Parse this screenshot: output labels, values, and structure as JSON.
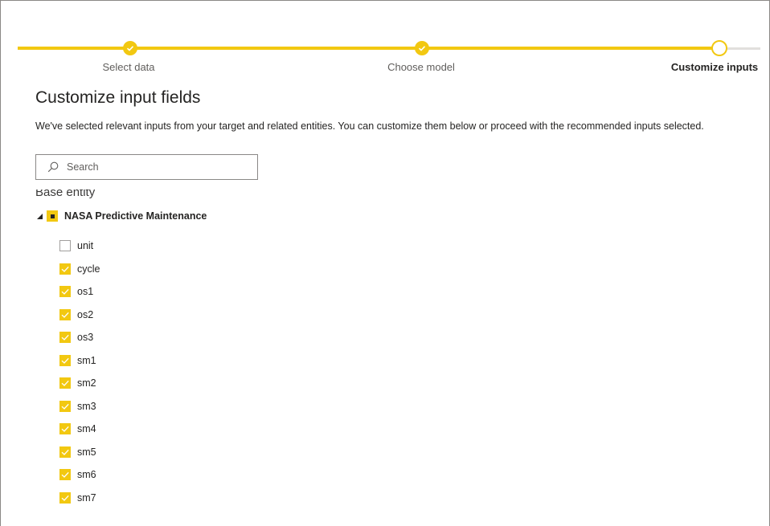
{
  "stepper": {
    "steps": [
      {
        "label": "Select data",
        "state": "done"
      },
      {
        "label": "Choose model",
        "state": "done"
      },
      {
        "label": "Customize inputs",
        "state": "current"
      }
    ]
  },
  "page": {
    "title": "Customize input fields",
    "description": "We've selected relevant inputs from your target and related entities. You can customize them below or proceed with the recommended inputs selected."
  },
  "search": {
    "placeholder": "Search",
    "value": ""
  },
  "tree": {
    "section_label": "Base entity",
    "entity": {
      "name": "NASA Predictive Maintenance",
      "state": "partial",
      "expanded": true
    },
    "fields": [
      {
        "name": "unit",
        "checked": false
      },
      {
        "name": "cycle",
        "checked": true
      },
      {
        "name": "os1",
        "checked": true
      },
      {
        "name": "os2",
        "checked": true
      },
      {
        "name": "os3",
        "checked": true
      },
      {
        "name": "sm1",
        "checked": true
      },
      {
        "name": "sm2",
        "checked": true
      },
      {
        "name": "sm3",
        "checked": true
      },
      {
        "name": "sm4",
        "checked": true
      },
      {
        "name": "sm5",
        "checked": true
      },
      {
        "name": "sm6",
        "checked": true
      },
      {
        "name": "sm7",
        "checked": true
      }
    ]
  },
  "colors": {
    "accent": "#f2c811",
    "track_inactive": "#e1dfdd",
    "text": "#252423",
    "muted": "#605e5c"
  }
}
